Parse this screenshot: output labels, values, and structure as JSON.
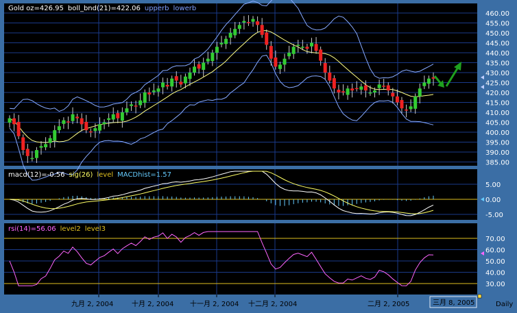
{
  "panels": {
    "price": {
      "legend": [
        {
          "text": "Gold oz=426.95",
          "color": "#ffffff"
        },
        {
          "text": "boll_bnd(21)=422.06",
          "color": "#ffffff"
        },
        {
          "text": "upperb",
          "color": "#7fa0ff"
        },
        {
          "text": "lowerb",
          "color": "#7fa0ff"
        }
      ],
      "yticks": [
        "460.00",
        "455.00",
        "450.00",
        "445.00",
        "440.00",
        "435.00",
        "430.00",
        "425.00",
        "420.00",
        "415.00",
        "410.00",
        "405.00",
        "400.00",
        "395.00",
        "390.00",
        "385.00"
      ]
    },
    "macd": {
      "legend": [
        {
          "text": "macd(12)=-0.56",
          "color": "#ffffff"
        },
        {
          "text": "sig(26)",
          "color": "#ffff66"
        },
        {
          "text": "level",
          "color": "#e0c020"
        },
        {
          "text": "MACDhist=1.57",
          "color": "#66ccff"
        }
      ],
      "yticks": [
        "5.00",
        "0.00",
        "-5.00"
      ]
    },
    "rsi": {
      "legend": [
        {
          "text": "rsi(14)=56.06",
          "color": "#ff66ff"
        },
        {
          "text": "level2",
          "color": "#e0c020"
        },
        {
          "text": "level3",
          "color": "#e0c020"
        }
      ],
      "yticks": [
        "70.00",
        "60.00",
        "50.00",
        "40.00",
        "30.00"
      ]
    }
  },
  "xaxis": {
    "labels": [
      "九月 2, 2004",
      "十月 2, 2004",
      "十一月 2, 2004",
      "十二月 2, 2004",
      "二月 2, 2005"
    ],
    "cursor_label": "三月 8, 2005",
    "period": "Daily"
  },
  "colors": {
    "background": "#000000",
    "frame": "#3b6ea5",
    "grid": "#1a3a8a",
    "up_candle": "#33cc33",
    "down_candle": "#ee2222",
    "bollinger_mid": "#ffff88",
    "bollinger_band": "#88aaff",
    "macd_line": "#ffffff",
    "macd_signal": "#ffff66",
    "macd_hist": "#66ccff",
    "rsi_line": "#ff66ff",
    "level_line": "#e0c020",
    "arrow": "#1fa01f"
  },
  "chart_data": {
    "type": "candlestick",
    "series": [
      {
        "name": "Gold oz",
        "close_path": [
          407,
          404,
          398,
          391,
          388,
          387,
          391,
          393,
          394,
          397,
          401,
          403,
          406,
          405,
          409,
          407,
          404,
          401,
          400,
          402,
          404,
          405,
          407,
          409,
          407,
          410,
          412,
          414,
          413,
          416,
          420,
          419,
          421,
          422,
          425,
          423,
          427,
          426,
          424,
          428,
          430,
          433,
          432,
          435,
          437,
          440,
          443,
          445,
          447,
          450,
          452,
          454,
          456,
          455,
          457,
          454,
          449,
          444,
          437,
          433,
          434,
          437,
          440,
          443,
          444,
          443,
          442,
          445,
          441,
          436,
          430,
          426,
          422,
          420,
          420,
          422,
          421,
          422,
          423,
          421,
          420,
          421,
          424,
          423,
          421,
          418,
          415,
          412,
          411,
          413,
          418,
          422,
          425,
          427,
          426.95
        ]
      }
    ],
    "bollinger": {
      "period": 21,
      "value": 422.06
    },
    "macd": {
      "macd": -0.56,
      "macd_hist": 1.57
    },
    "rsi": {
      "period": 14,
      "value": 56.06
    }
  }
}
